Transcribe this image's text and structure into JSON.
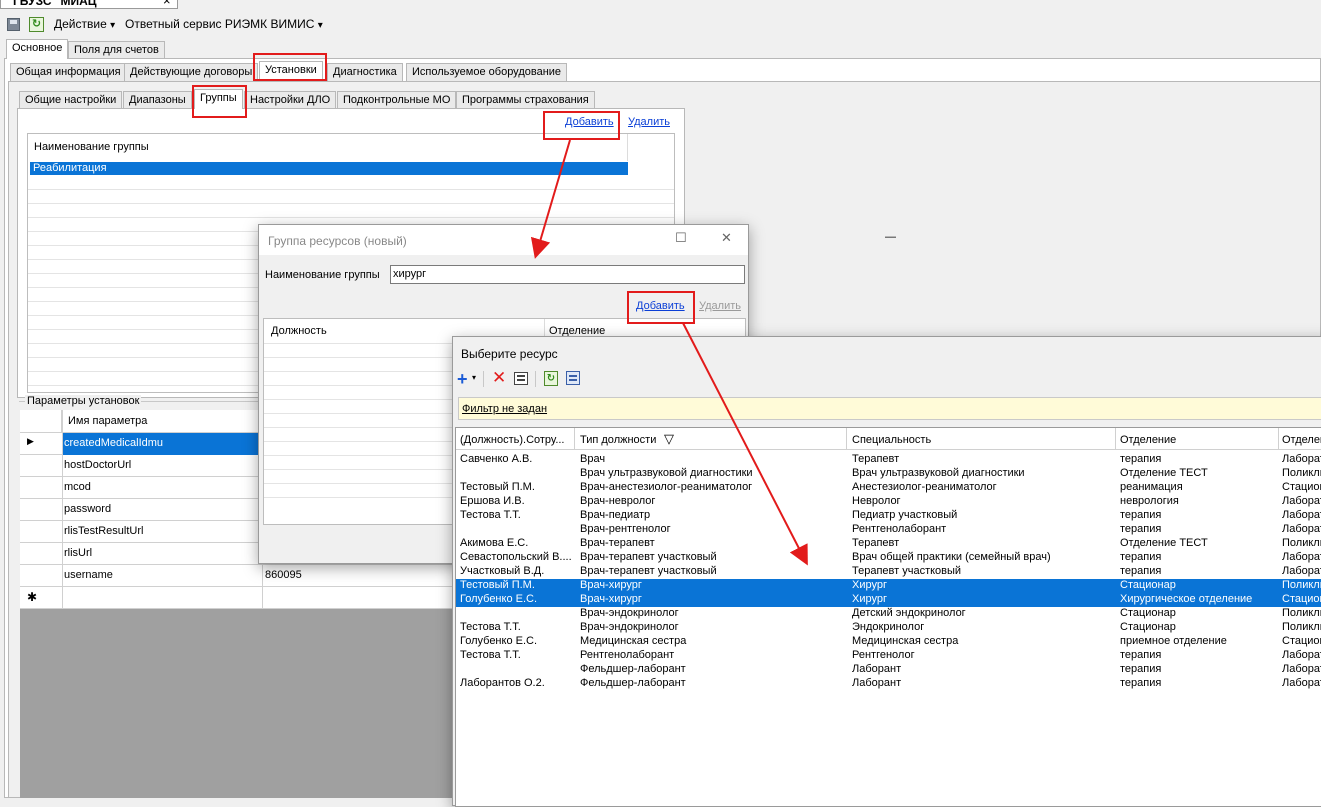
{
  "window_tab": "ГБУЗС \"МИАЦ\"",
  "window_tab_close": "×",
  "toolbar": {
    "action_label": "Действие",
    "service_label": "Ответный сервис РИЭМК ВИМИС",
    "dropdown": "▾"
  },
  "tabs_l1": [
    "Основное",
    "Поля для счетов"
  ],
  "tabs_l2": [
    "Общая информация",
    "Действующие договоры",
    "Установки",
    "Диагностика",
    "Используемое оборудование"
  ],
  "tabs_l3": [
    "Общие настройки",
    "Диапазоны",
    "Группы",
    "Настройки ДЛО",
    "Подконтрольные МО",
    "Программы страхования"
  ],
  "groups": {
    "add": "Добавить",
    "delete": "Удалить",
    "column": "Наименование группы",
    "rows": [
      "Реабилитация"
    ]
  },
  "params": {
    "title": "Параметры установок",
    "column": "Имя параметра",
    "current_marker": "▶",
    "new_marker": "✱",
    "rows": [
      {
        "name": "createdMedicalIdmu",
        "value": ""
      },
      {
        "name": "hostDoctorUrl",
        "value": ""
      },
      {
        "name": "mcod",
        "value": ""
      },
      {
        "name": "password",
        "value": ""
      },
      {
        "name": "rlisTestResultUrl",
        "value": ""
      },
      {
        "name": "rlisUrl",
        "value": ""
      },
      {
        "name": "username",
        "value": "860095"
      }
    ]
  },
  "dialog1": {
    "title": "Группа ресурсов (новый)",
    "name_label": "Наименование группы",
    "name_value": "хирург",
    "add": "Добавить",
    "delete": "Удалить",
    "col_position": "Должность",
    "col_department": "Отделение",
    "btn_minimize": "—",
    "btn_maximize": "☐",
    "btn_close": "✕"
  },
  "dialog2": {
    "title": "Выберите ресурс",
    "filter": "Фильтр не задан",
    "columns": [
      "(Должность).Сотру...",
      "Тип должности",
      "Специальность",
      "Отделение",
      "Отделен"
    ],
    "sort_glyph": "▽",
    "rows": [
      {
        "emp": "Савченко А.В.",
        "type": "Врач",
        "spec": "Терапевт",
        "dept": "терапия",
        "dept2": "Лаборат",
        "selected": false
      },
      {
        "emp": "",
        "type": "Врач ультразвуковой диагностики",
        "spec": "Врач ультразвуковой диагностики",
        "dept": "Отделение ТЕСТ",
        "dept2": "Поликли",
        "selected": false
      },
      {
        "emp": "Тестовый П.М.",
        "type": "Врач-анестезиолог-реаниматолог",
        "spec": "Анестезиолог-реаниматолог",
        "dept": "реанимация",
        "dept2": "Стацион",
        "selected": false
      },
      {
        "emp": "Ершова И.В.",
        "type": "Врач-невролог",
        "spec": "Невролог",
        "dept": "неврология",
        "dept2": "Лаборат",
        "selected": false
      },
      {
        "emp": "Тестова Т.Т.",
        "type": "Врач-педиатр",
        "spec": "Педиатр участковый",
        "dept": "терапия",
        "dept2": "Лаборат",
        "selected": false
      },
      {
        "emp": "",
        "type": "Врач-рентгенолог",
        "spec": "Рентгенолаборант",
        "dept": "терапия",
        "dept2": "Лаборат",
        "selected": false
      },
      {
        "emp": "Акимова Е.С.",
        "type": "Врач-терапевт",
        "spec": "Терапевт",
        "dept": "Отделение ТЕСТ",
        "dept2": "Поликли",
        "selected": false
      },
      {
        "emp": "Севастопольский В....",
        "type": "Врач-терапевт участковый",
        "spec": "Врач общей практики (семейный врач)",
        "dept": "терапия",
        "dept2": "Лаборат",
        "selected": false
      },
      {
        "emp": "Участковый В.Д.",
        "type": "Врач-терапевт участковый",
        "spec": "Терапевт участковый",
        "dept": "терапия",
        "dept2": "Лаборат",
        "selected": false
      },
      {
        "emp": "Тестовый П.М.",
        "type": "Врач-хирург",
        "spec": "Хирург",
        "dept": "Стационар",
        "dept2": "Поликли",
        "selected": true
      },
      {
        "emp": "Голубенко Е.С.",
        "type": "Врач-хирург",
        "spec": "Хирург",
        "dept": "Хирургическое отделение",
        "dept2": "Стацион",
        "selected": true
      },
      {
        "emp": "",
        "type": "Врач-эндокринолог",
        "spec": "Детский эндокринолог",
        "dept": "Стационар",
        "dept2": "Поликли",
        "selected": false
      },
      {
        "emp": "Тестова Т.Т.",
        "type": "Врач-эндокринолог",
        "spec": "Эндокринолог",
        "dept": "Стационар",
        "dept2": "Поликли",
        "selected": false
      },
      {
        "emp": "Голубенко Е.С.",
        "type": "Медицинская сестра",
        "spec": "Медицинская сестра",
        "dept": "приемное отделение",
        "dept2": "Стацион",
        "selected": false
      },
      {
        "emp": "Тестова Т.Т.",
        "type": "Рентгенолаборант",
        "spec": "Рентгенолог",
        "dept": "терапия",
        "dept2": "Лаборат",
        "selected": false
      },
      {
        "emp": "",
        "type": "Фельдшер-лаборант",
        "spec": "Лаборант",
        "dept": "терапия",
        "dept2": "Лаборат",
        "selected": false
      },
      {
        "emp": "Лаборантов О.2.",
        "type": "Фельдшер-лаборант",
        "spec": "Лаборант",
        "dept": "терапия",
        "dept2": "Лаборат",
        "selected": false
      }
    ]
  },
  "colors": {
    "selection": "#0a74d6",
    "annotation": "#e21b1b",
    "link": "#0b3fd6",
    "filter_bg": "#fffbd8"
  }
}
